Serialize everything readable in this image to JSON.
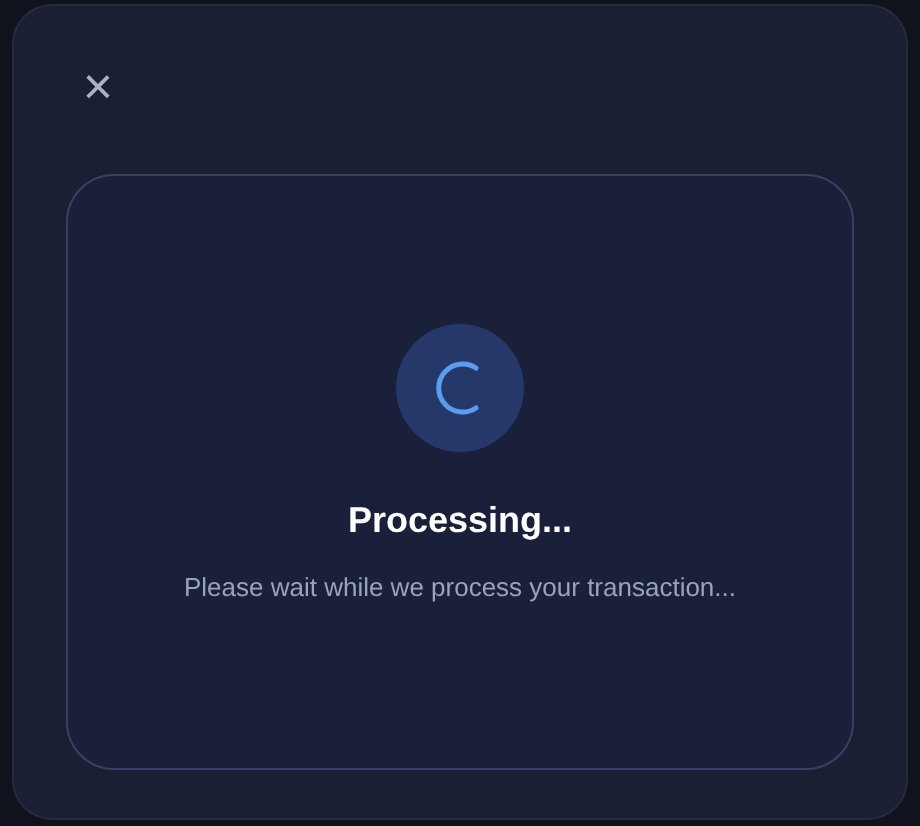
{
  "dialog": {
    "close_label": "×",
    "status": {
      "title": "Processing...",
      "message": "Please wait while we process your transaction..."
    }
  }
}
